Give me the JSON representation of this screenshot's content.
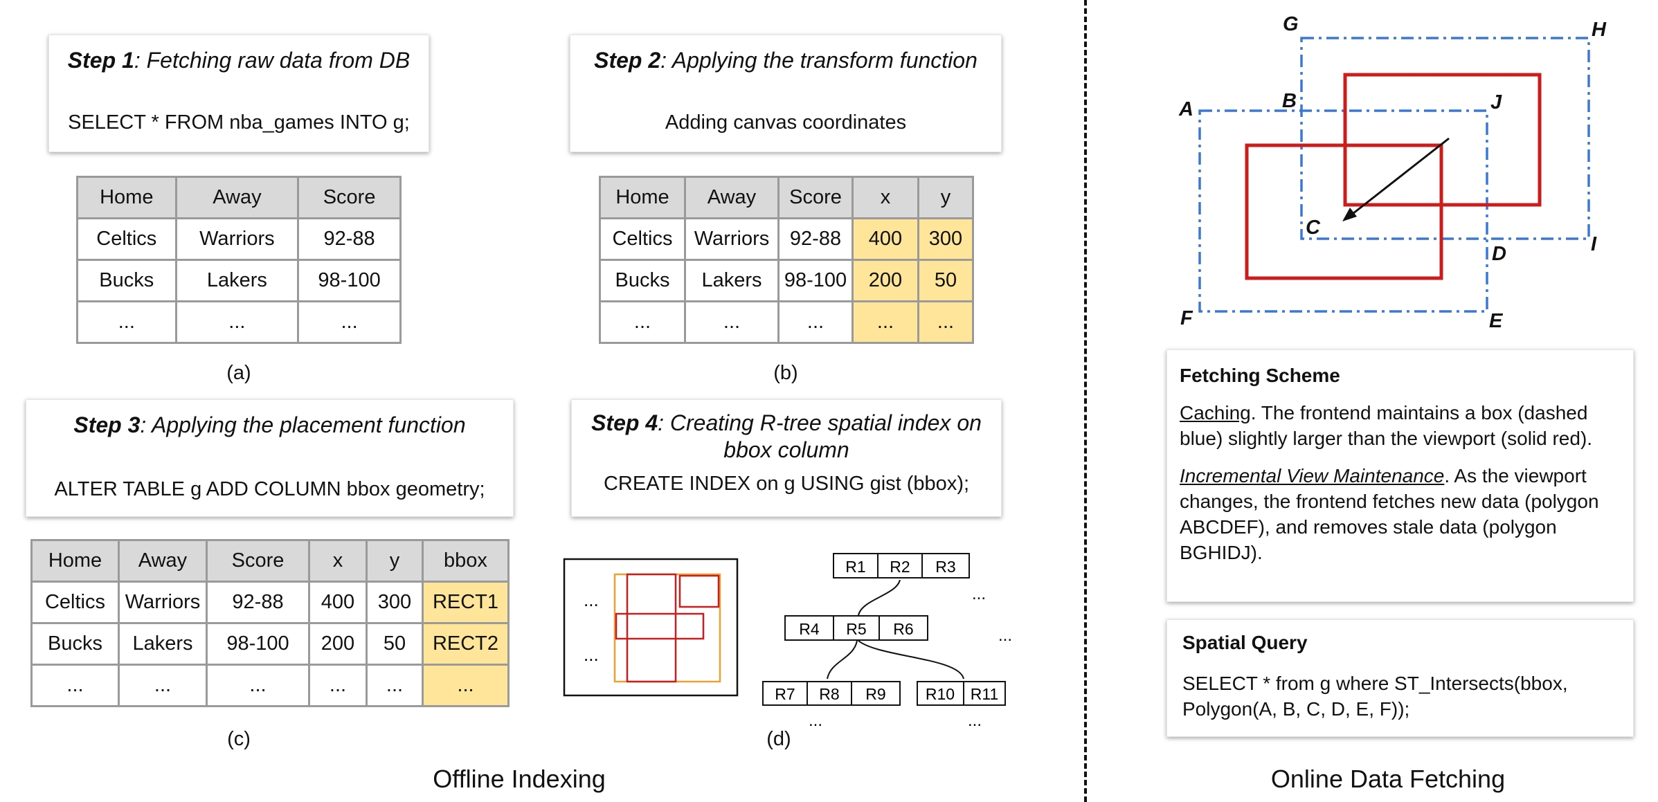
{
  "step1": {
    "title_bold": "Step 1",
    "title_rest": ": Fetching raw data from DB",
    "body": "SELECT * FROM nba_games INTO g;"
  },
  "step2": {
    "title_bold": "Step 2",
    "title_rest": ": Applying the transform function",
    "body": "Adding canvas coordinates"
  },
  "step3": {
    "title_bold": "Step 3",
    "title_rest": ": Applying the placement function",
    "body": "ALTER TABLE g ADD COLUMN bbox geometry;"
  },
  "step4": {
    "title_bold": "Step 4",
    "title_rest_line1": ": Creating R-tree spatial index on",
    "title_rest_line2": "bbox column",
    "body": "CREATE INDEX  on g USING gist (bbox);"
  },
  "table_a": {
    "headers": [
      "Home",
      "Away",
      "Score"
    ],
    "rows": [
      [
        "Celtics",
        "Warriors",
        "92-88"
      ],
      [
        "Bucks",
        "Lakers",
        "98-100"
      ],
      [
        "...",
        "...",
        "..."
      ]
    ]
  },
  "table_b": {
    "headers": [
      "Home",
      "Away",
      "Score",
      "x",
      "y"
    ],
    "rows": [
      [
        "Celtics",
        "Warriors",
        "92-88",
        "400",
        "300"
      ],
      [
        "Bucks",
        "Lakers",
        "98-100",
        "200",
        "50"
      ],
      [
        "...",
        "...",
        "...",
        "...",
        "..."
      ]
    ]
  },
  "table_c": {
    "headers": [
      "Home",
      "Away",
      "Score",
      "x",
      "y",
      "bbox"
    ],
    "rows": [
      [
        "Celtics",
        "Warriors",
        "92-88",
        "400",
        "300",
        "RECT1"
      ],
      [
        "Bucks",
        "Lakers",
        "98-100",
        "200",
        "50",
        "RECT2"
      ],
      [
        "...",
        "...",
        "...",
        "...",
        "...",
        "..."
      ]
    ]
  },
  "captions": {
    "a": "(a)",
    "b": "(b)",
    "c": "(c)",
    "d": "(d)"
  },
  "rtree": {
    "ellipsis": "...",
    "root": [
      "R1",
      "R2",
      "R3"
    ],
    "mid": [
      "R4",
      "R5",
      "R6"
    ],
    "leaf_left": [
      "R7",
      "R8",
      "R9"
    ],
    "leaf_right": [
      "R10",
      "R11"
    ]
  },
  "sections": {
    "offline": "Offline Indexing",
    "online": "Online Data Fetching"
  },
  "points": {
    "A": "A",
    "B": "B",
    "C": "C",
    "D": "D",
    "E": "E",
    "F": "F",
    "G": "G",
    "H": "H",
    "I": "I",
    "J": "J"
  },
  "colors": {
    "viewport": "#cc1c1c",
    "box": "#3a78d6",
    "highlight": "#ffe59a",
    "index_box": "#f0a030"
  },
  "fetching": {
    "heading": "Fetching Scheme",
    "p1_term": "Caching",
    "p1_rest": ". The frontend maintains a box (dashed blue) slightly larger than the viewport (solid red).",
    "p2_term": "Incremental View Maintenance",
    "p2_rest": ". As the viewport changes, the frontend fetches new data (polygon ABCDEF), and removes stale data (polygon BGHIDJ)."
  },
  "spatial": {
    "heading": "Spatial Query",
    "line1": "SELECT * from g where ST_Intersects(bbox,",
    "line2": "Polygon(A, B, C, D, E, F));"
  }
}
